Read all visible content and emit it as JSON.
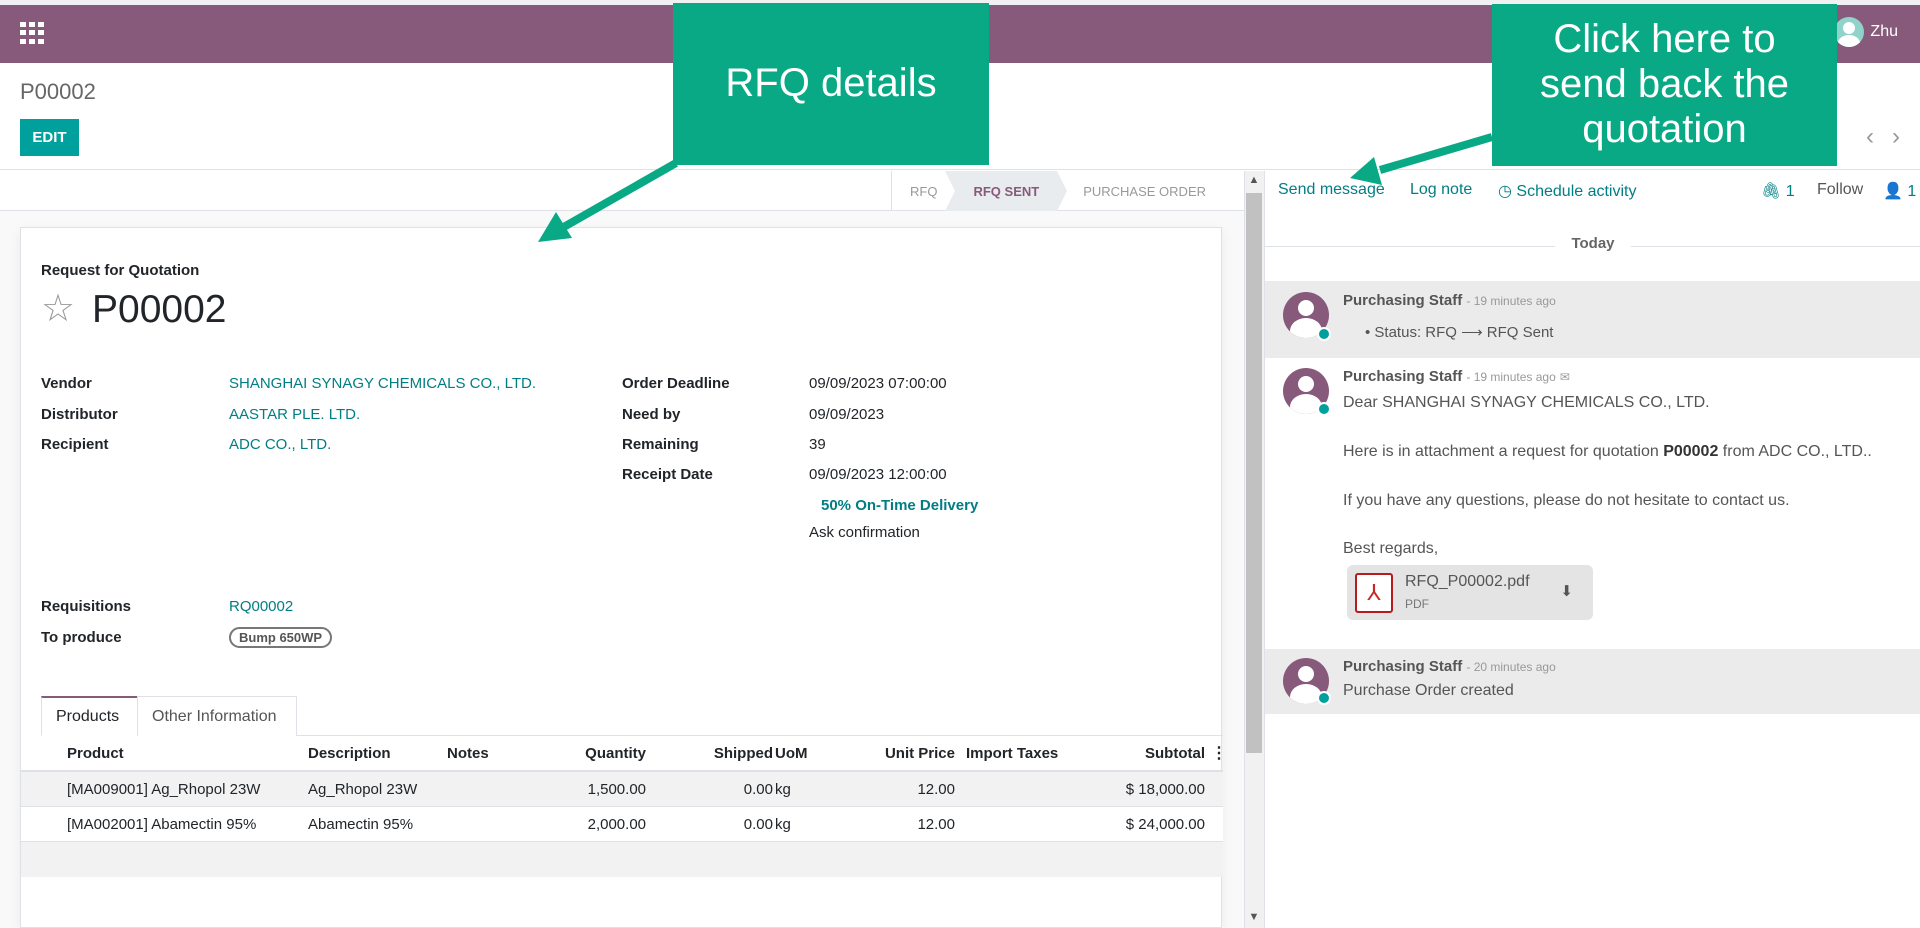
{
  "topbar": {
    "user": "Zhu"
  },
  "control": {
    "breadcrumb": "P00002",
    "edit_label": "EDIT",
    "prev": "‹",
    "next": "›"
  },
  "status": {
    "steps": [
      "RFQ",
      "RFQ SENT",
      "PURCHASE ORDER"
    ],
    "active": "RFQ SENT"
  },
  "form": {
    "doc_type": "Request for Quotation",
    "name": "P00002",
    "vendor_label": "Vendor",
    "vendor": "SHANGHAI SYNAGY CHEMICALS CO., LTD.",
    "distributor_label": "Distributor",
    "distributor": "AASTAR PLE. LTD.",
    "recipient_label": "Recipient",
    "recipient": "ADC CO., LTD.",
    "order_deadline_label": "Order Deadline",
    "order_deadline": "09/09/2023 07:00:00",
    "need_by_label": "Need by",
    "need_by": "09/09/2023",
    "remaining_label": "Remaining",
    "remaining": "39",
    "receipt_date_label": "Receipt Date",
    "receipt_date": "09/09/2023 12:00:00",
    "on_time": "50% On-Time Delivery",
    "ask_confirmation": "Ask confirmation",
    "requisitions_label": "Requisitions",
    "requisitions": "RQ00002",
    "to_produce_label": "To produce",
    "to_produce": "Bump 650WP"
  },
  "tabs": [
    "Products",
    "Other Information"
  ],
  "lines": {
    "headers": [
      "Product",
      "Description",
      "Notes",
      "Quantity",
      "Shipped",
      "UoM",
      "Unit Price",
      "Import Taxes",
      "Subtotal"
    ],
    "rows": [
      [
        "[MA009001] Ag_Rhopol 23W",
        "Ag_Rhopol 23W",
        "",
        "1,500.00",
        "0.00",
        "kg",
        "12.00",
        "",
        "$ 18,000.00"
      ],
      [
        "[MA002001] Abamectin 95%",
        "Abamectin 95%",
        "",
        "2,000.00",
        "0.00",
        "kg",
        "12.00",
        "",
        "$ 24,000.00"
      ]
    ]
  },
  "chatter": {
    "send_message": "Send message",
    "log_note": "Log note",
    "schedule_activity": "Schedule activity",
    "attachments_count": "1",
    "follow": "Follow",
    "followers_count": "1",
    "today": "Today",
    "messages": [
      {
        "author": "Purchasing Staff",
        "date": "- 19 minutes ago",
        "body": "Status: RFQ ⟶ RFQ Sent"
      },
      {
        "author": "Purchasing Staff",
        "date": "- 19 minutes ago",
        "greeting": "Dear SHANGHAI SYNAGY CHEMICALS CO., LTD.",
        "line1_pre": "Here is in attachment a request for quotation ",
        "line1_bold": "P00002",
        "line1_post": " from ADC CO., LTD..",
        "line2": "If you have any questions, please do not hesitate to contact us.",
        "line3": "Best regards,",
        "attachment_name": "RFQ_P00002.pdf",
        "attachment_type": "PDF"
      },
      {
        "author": "Purchasing Staff",
        "date": "- 20 minutes ago",
        "body": "Purchase Order created"
      }
    ]
  },
  "callouts": {
    "rfq_details": "RFQ details",
    "send_back": [
      "Click here to",
      "send back the",
      "quotation"
    ]
  },
  "colors": {
    "brand": "#875a7b",
    "accent": "#00a09d",
    "callout": "#0aa985",
    "link": "#017e84"
  }
}
